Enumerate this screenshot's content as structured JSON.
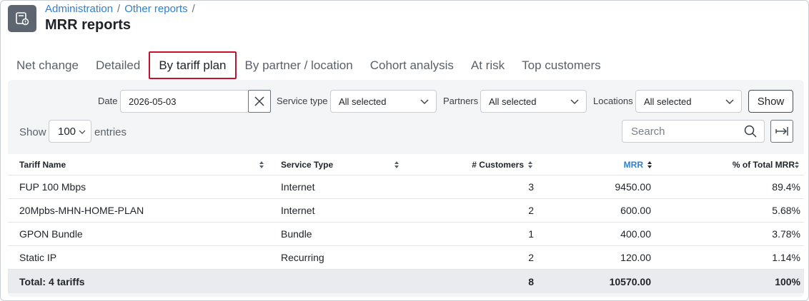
{
  "breadcrumb": [
    "Administration",
    "Other reports"
  ],
  "page_title": "MRR reports",
  "tabs": [
    {
      "label": "Net change",
      "active": false
    },
    {
      "label": "Detailed",
      "active": false
    },
    {
      "label": "By tariff plan",
      "active": true
    },
    {
      "label": "By partner / location",
      "active": false
    },
    {
      "label": "Cohort analysis",
      "active": false
    },
    {
      "label": "At risk",
      "active": false
    },
    {
      "label": "Top customers",
      "active": false
    }
  ],
  "filters": {
    "date_label": "Date",
    "date_value": "2026-05-03",
    "service_type_label": "Service type",
    "service_type_value": "All selected",
    "partners_label": "Partners",
    "partners_value": "All selected",
    "locations_label": "Locations",
    "locations_value": "All selected",
    "show_button": "Show"
  },
  "table_controls": {
    "show_label": "Show",
    "page_length": "100",
    "entries_label": "entries",
    "search_placeholder": "Search"
  },
  "table": {
    "headers": [
      "Tariff Name",
      "Service Type",
      "# Customers",
      "MRR",
      "% of Total MRR"
    ],
    "rows": [
      [
        "FUP 100 Mbps",
        "Internet",
        "3",
        "9450.00",
        "89.4%"
      ],
      [
        "20Mpbs-MHN-HOME-PLAN",
        "Internet",
        "2",
        "600.00",
        "5.68%"
      ],
      [
        "GPON Bundle",
        "Bundle",
        "1",
        "400.00",
        "3.78%"
      ],
      [
        "Static IP",
        "Recurring",
        "2",
        "120.00",
        "1.14%"
      ]
    ],
    "total": [
      "Total: 4 tariffs",
      "8",
      "10570.00",
      "100%"
    ]
  },
  "colors": {
    "accent": "#2f7ed8",
    "active_tab_border": "#c8102e",
    "icon_bg": "#5d6670"
  }
}
